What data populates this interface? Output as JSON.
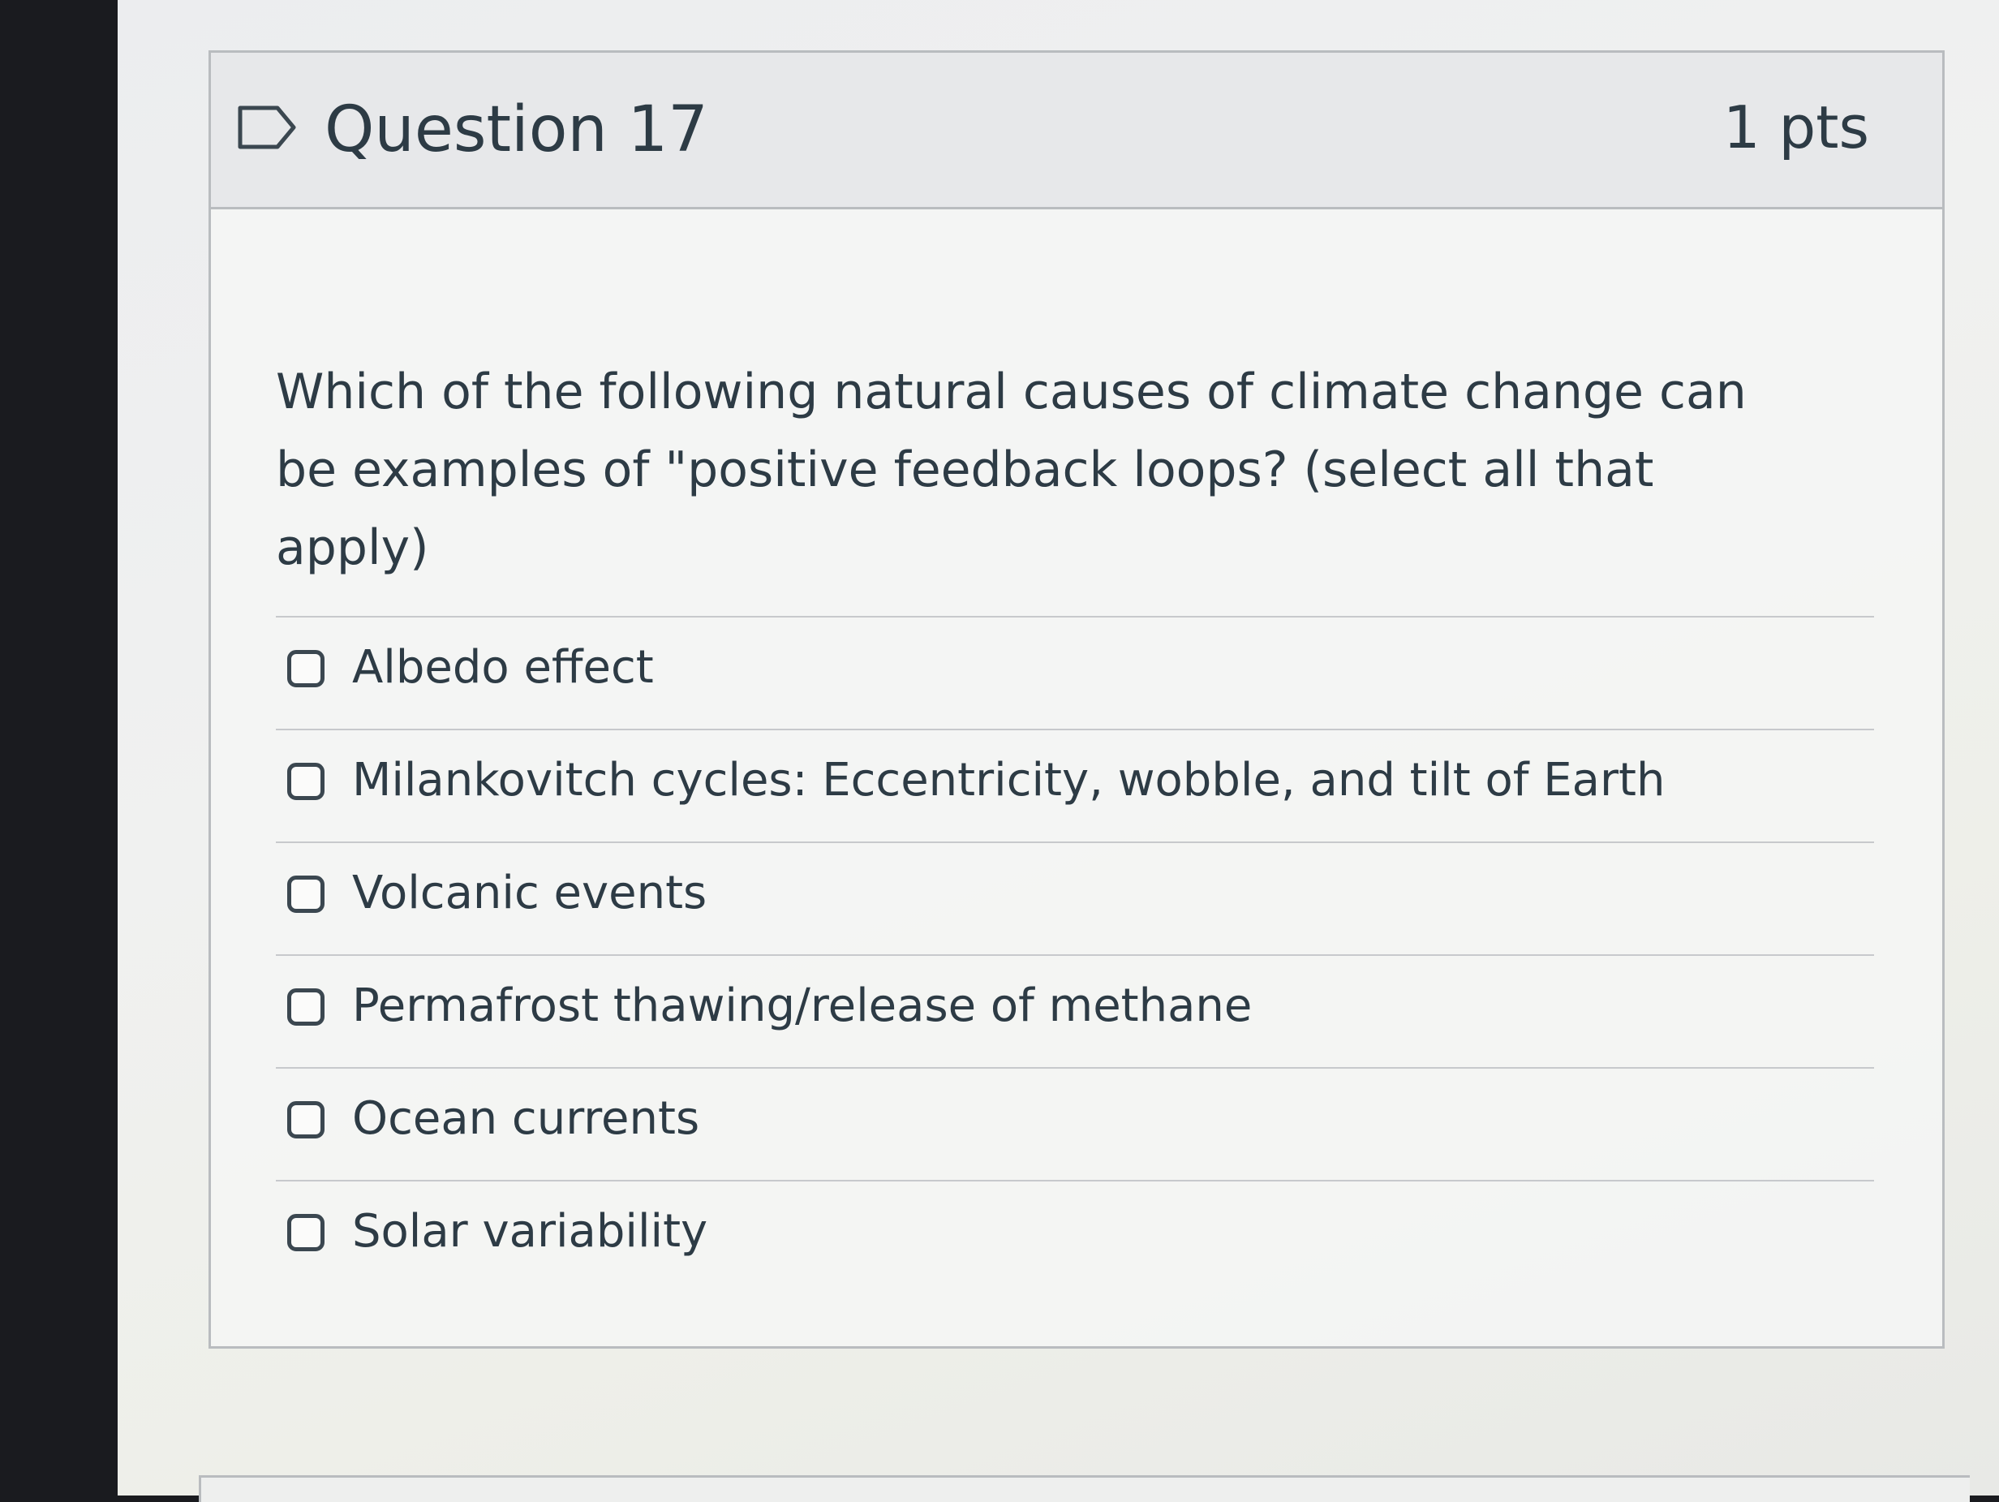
{
  "question": {
    "title": "Question 17",
    "points": "1 pts",
    "text": "Which of the following natural causes of climate change can be examples of \"positive feedback loops? (select all that apply)",
    "flag_icon": "flag-outline-icon",
    "answers": [
      {
        "label": "Albedo effect",
        "checked": false
      },
      {
        "label": "Milankovitch cycles: Eccentricity, wobble, and tilt of Earth",
        "checked": false
      },
      {
        "label": "Volcanic events",
        "checked": false
      },
      {
        "label": "Permafrost thawing/release of methane",
        "checked": false
      },
      {
        "label": "Ocean currents",
        "checked": false
      },
      {
        "label": "Solar variability",
        "checked": false
      }
    ]
  },
  "colors": {
    "text": "#2d3b45",
    "border": "#b9bcbf",
    "header_bg": "#e7e8ea"
  }
}
